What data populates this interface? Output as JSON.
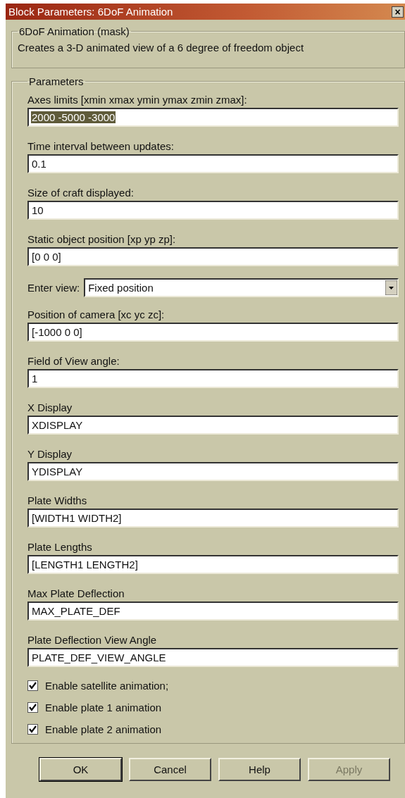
{
  "window": {
    "title": "Block Parameters: 6DoF Animation",
    "close": "×"
  },
  "description_group": {
    "title": "6DoF Animation (mask)",
    "text": "Creates a 3-D animated view of a 6 degree of freedom object"
  },
  "parameters_group": {
    "title": "Parameters",
    "fields": [
      {
        "kind": "text",
        "label": "Axes limits [xmin xmax ymin ymax zmin zmax]:",
        "value": "2000 -5000 -3000",
        "text_selected": true
      },
      {
        "kind": "text",
        "label": "Time interval between updates:",
        "value": "0.1",
        "text_selected": false
      },
      {
        "kind": "text",
        "label": "Size of craft displayed:",
        "value": "10",
        "text_selected": false
      },
      {
        "kind": "text",
        "label": "Static object position [xp yp zp]:",
        "value": "[0 0 0]",
        "text_selected": false
      },
      {
        "kind": "dropdown",
        "label": "Enter view:",
        "value": "Fixed position",
        "text_selected": false
      },
      {
        "kind": "text",
        "label": "Position of camera [xc yc zc]:",
        "value": "[-1000 0 0]",
        "text_selected": false
      },
      {
        "kind": "text",
        "label": "Field of View angle:",
        "value": "1",
        "text_selected": false
      },
      {
        "kind": "text",
        "label": "X Display",
        "value": "XDISPLAY",
        "text_selected": false
      },
      {
        "kind": "text",
        "label": "Y Display",
        "value": "YDISPLAY",
        "text_selected": false
      },
      {
        "kind": "text",
        "label": "Plate Widths",
        "value": "[WIDTH1 WIDTH2]",
        "text_selected": false
      },
      {
        "kind": "text",
        "label": "Plate Lengths",
        "value": "[LENGTH1 LENGTH2]",
        "text_selected": false
      },
      {
        "kind": "text",
        "label": "Max Plate Deflection",
        "value": "MAX_PLATE_DEF",
        "text_selected": false
      },
      {
        "kind": "text",
        "label": "Plate Deflection View Angle",
        "value": "PLATE_DEF_VIEW_ANGLE",
        "text_selected": false
      }
    ],
    "checkboxes": [
      {
        "label": "Enable satellite animation;",
        "checked": true
      },
      {
        "label": "Enable plate 1 animation",
        "checked": true
      },
      {
        "label": "Enable plate 2 animation",
        "checked": true
      }
    ]
  },
  "buttons": [
    {
      "label": "OK",
      "default": true,
      "disabled": false
    },
    {
      "label": "Cancel",
      "default": false,
      "disabled": false
    },
    {
      "label": "Help",
      "default": false,
      "disabled": false
    },
    {
      "label": "Apply",
      "default": false,
      "disabled": true
    }
  ]
}
